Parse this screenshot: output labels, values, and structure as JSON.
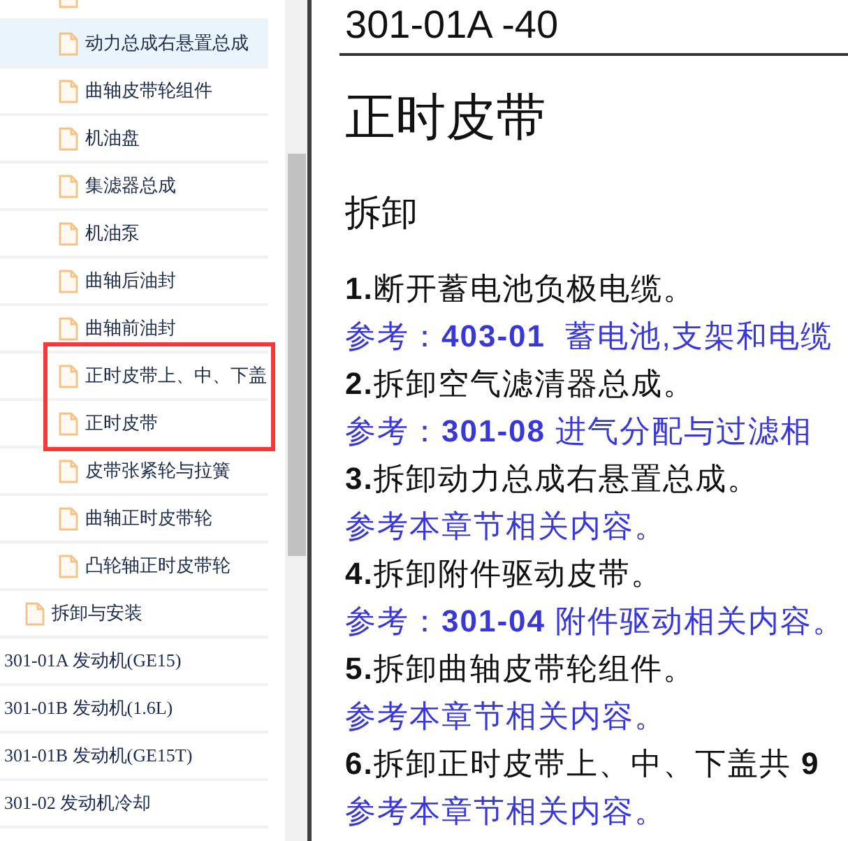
{
  "sidebar": {
    "items": [
      {
        "children": [
          {
            "children": [
              {
                "kind": "page",
                "selected": false,
                "highlighted": false
              },
              {
                "label": "动力总成右悬置总成",
                "kind": "page",
                "selected": true,
                "highlighted": false
              },
              {
                "label": "曲轴皮带轮组件",
                "kind": "page",
                "selected": false,
                "highlighted": false
              },
              {
                "label": "机油盘",
                "kind": "page",
                "selected": false,
                "highlighted": false
              },
              {
                "label": "集滤器总成",
                "kind": "page",
                "selected": false,
                "highlighted": false
              },
              {
                "label": "机油泵",
                "kind": "page",
                "selected": false,
                "highlighted": false
              },
              {
                "label": "曲轴后油封",
                "kind": "page",
                "selected": false,
                "highlighted": false
              },
              {
                "label": "曲轴前油封",
                "kind": "page",
                "selected": false,
                "highlighted": false
              },
              {
                "label": "正时皮带上、中、下盖",
                "kind": "page",
                "selected": false,
                "highlighted": true
              },
              {
                "label": "正时皮带",
                "kind": "page",
                "selected": false,
                "highlighted": true
              },
              {
                "label": "皮带张紧轮与拉簧",
                "kind": "page",
                "selected": false,
                "highlighted": false
              },
              {
                "label": "曲轴正时皮带轮",
                "kind": "page",
                "selected": false,
                "highlighted": false
              },
              {
                "label": "凸轮轴正时皮带轮",
                "kind": "page",
                "selected": false,
                "highlighted": false
              }
            ]
          },
          {
            "label": "拆卸与安装",
            "kind": "page",
            "selected": false,
            "highlighted": false
          }
        ]
      },
      {
        "label": "301-01A 发动机(GE15)",
        "kind": "chapter",
        "selected": false,
        "highlighted": false
      },
      {
        "label": "301-01B 发动机(1.6L)",
        "kind": "chapter",
        "selected": false,
        "highlighted": false
      },
      {
        "label": "301-01B 发动机(GE15T)",
        "kind": "chapter",
        "selected": false,
        "highlighted": false
      },
      {
        "label": "301-02 发动机冷却",
        "kind": "chapter",
        "selected": false,
        "highlighted": false
      }
    ]
  },
  "document": {
    "header": "301-01A -40",
    "title": "正时皮带",
    "section": "拆卸",
    "lines": [
      {
        "kind": "step",
        "text": "**1.**断开蓄电池负极电缆。"
      },
      {
        "kind": "reference",
        "text": "参考：**403-01**  蓄电池,支架和电缆"
      },
      {
        "kind": "step",
        "text": "**2.**拆卸空气滤清器总成。"
      },
      {
        "kind": "reference",
        "text": "参考：**301-08** 进气分配与过滤相"
      },
      {
        "kind": "step",
        "text": "**3.**拆卸动力总成右悬置总成。"
      },
      {
        "kind": "reference",
        "text": "参考本章节相关内容。"
      },
      {
        "kind": "step",
        "text": "**4.**拆卸附件驱动皮带。"
      },
      {
        "kind": "reference",
        "text": "参考：**301-04** 附件驱动相关内容。"
      },
      {
        "kind": "step",
        "text": "**5.**拆卸曲轴皮带轮组件。"
      },
      {
        "kind": "reference",
        "text": "参考本章节相关内容。"
      },
      {
        "kind": "step",
        "text": "**6.**拆卸正时皮带上、中、下盖共 **9**"
      },
      {
        "kind": "reference",
        "text": "参考本章节相关内容。"
      }
    ]
  }
}
